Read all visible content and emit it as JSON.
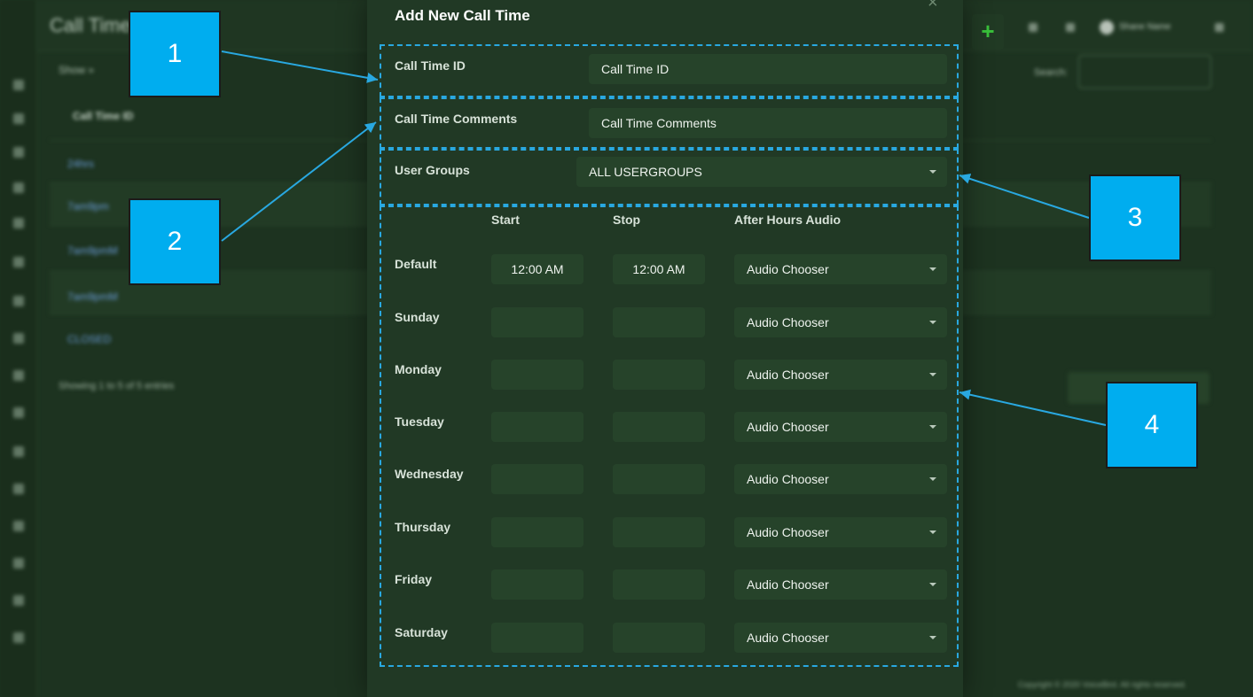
{
  "background": {
    "page_title": "Call Time",
    "breadcrumb": "Show  »",
    "column_header": "Call Time ID",
    "rows": [
      "24hrs",
      "7am9pm",
      "7am9pmM",
      "7am9pmM",
      "CLOSED"
    ],
    "table_info": "Showing 1 to 5 of 5 entries",
    "search_label": "Search:",
    "add_button": "+",
    "user_name": "Shane Name",
    "footer": "Copyright © 2020 VoiceBird. All rights reserved."
  },
  "modal": {
    "title": "Add New Call Time",
    "close": "×",
    "call_time_id": {
      "label": "Call Time ID",
      "placeholder": "Call Time ID"
    },
    "call_time_comments": {
      "label": "Call Time Comments",
      "placeholder": "Call Time Comments"
    },
    "user_groups": {
      "label": "User Groups",
      "value": "ALL USERGROUPS"
    },
    "schedule": {
      "headers": {
        "start": "Start",
        "stop": "Stop",
        "audio": "After Hours Audio"
      },
      "rows": [
        {
          "day": "Default",
          "start": "12:00 AM",
          "stop": "12:00 AM",
          "audio": "Audio Chooser"
        },
        {
          "day": "Sunday",
          "start": "",
          "stop": "",
          "audio": "Audio Chooser"
        },
        {
          "day": "Monday",
          "start": "",
          "stop": "",
          "audio": "Audio Chooser"
        },
        {
          "day": "Tuesday",
          "start": "",
          "stop": "",
          "audio": "Audio Chooser"
        },
        {
          "day": "Wednesday",
          "start": "",
          "stop": "",
          "audio": "Audio Chooser"
        },
        {
          "day": "Thursday",
          "start": "",
          "stop": "",
          "audio": "Audio Chooser"
        },
        {
          "day": "Friday",
          "start": "",
          "stop": "",
          "audio": "Audio Chooser"
        },
        {
          "day": "Saturday",
          "start": "",
          "stop": "",
          "audio": "Audio Chooser"
        }
      ]
    }
  },
  "callouts": [
    "1",
    "2",
    "3",
    "4"
  ],
  "colors": {
    "accent": "#00adef",
    "dashed": "#29a8e0",
    "modal_bg": "#213925",
    "field_bg": "#26432a"
  }
}
